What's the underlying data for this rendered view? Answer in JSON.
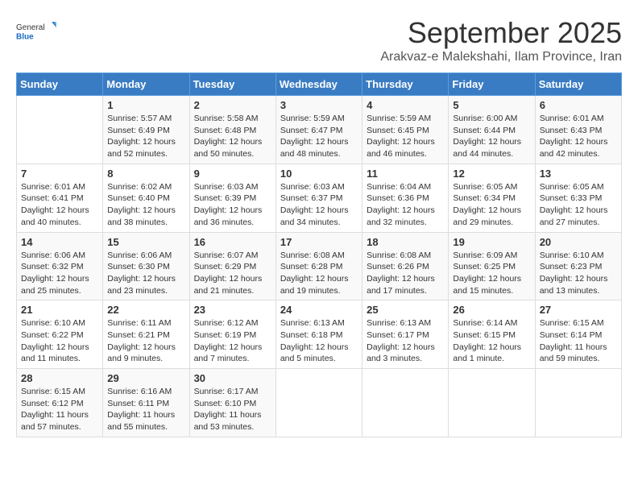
{
  "logo": {
    "general": "General",
    "blue": "Blue"
  },
  "title": "September 2025",
  "location": "Arakvaz-e Malekshahi, Ilam Province, Iran",
  "days_header": [
    "Sunday",
    "Monday",
    "Tuesday",
    "Wednesday",
    "Thursday",
    "Friday",
    "Saturday"
  ],
  "weeks": [
    [
      {
        "day": "",
        "info": ""
      },
      {
        "day": "1",
        "info": "Sunrise: 5:57 AM\nSunset: 6:49 PM\nDaylight: 12 hours\nand 52 minutes."
      },
      {
        "day": "2",
        "info": "Sunrise: 5:58 AM\nSunset: 6:48 PM\nDaylight: 12 hours\nand 50 minutes."
      },
      {
        "day": "3",
        "info": "Sunrise: 5:59 AM\nSunset: 6:47 PM\nDaylight: 12 hours\nand 48 minutes."
      },
      {
        "day": "4",
        "info": "Sunrise: 5:59 AM\nSunset: 6:45 PM\nDaylight: 12 hours\nand 46 minutes."
      },
      {
        "day": "5",
        "info": "Sunrise: 6:00 AM\nSunset: 6:44 PM\nDaylight: 12 hours\nand 44 minutes."
      },
      {
        "day": "6",
        "info": "Sunrise: 6:01 AM\nSunset: 6:43 PM\nDaylight: 12 hours\nand 42 minutes."
      }
    ],
    [
      {
        "day": "7",
        "info": "Sunrise: 6:01 AM\nSunset: 6:41 PM\nDaylight: 12 hours\nand 40 minutes."
      },
      {
        "day": "8",
        "info": "Sunrise: 6:02 AM\nSunset: 6:40 PM\nDaylight: 12 hours\nand 38 minutes."
      },
      {
        "day": "9",
        "info": "Sunrise: 6:03 AM\nSunset: 6:39 PM\nDaylight: 12 hours\nand 36 minutes."
      },
      {
        "day": "10",
        "info": "Sunrise: 6:03 AM\nSunset: 6:37 PM\nDaylight: 12 hours\nand 34 minutes."
      },
      {
        "day": "11",
        "info": "Sunrise: 6:04 AM\nSunset: 6:36 PM\nDaylight: 12 hours\nand 32 minutes."
      },
      {
        "day": "12",
        "info": "Sunrise: 6:05 AM\nSunset: 6:34 PM\nDaylight: 12 hours\nand 29 minutes."
      },
      {
        "day": "13",
        "info": "Sunrise: 6:05 AM\nSunset: 6:33 PM\nDaylight: 12 hours\nand 27 minutes."
      }
    ],
    [
      {
        "day": "14",
        "info": "Sunrise: 6:06 AM\nSunset: 6:32 PM\nDaylight: 12 hours\nand 25 minutes."
      },
      {
        "day": "15",
        "info": "Sunrise: 6:06 AM\nSunset: 6:30 PM\nDaylight: 12 hours\nand 23 minutes."
      },
      {
        "day": "16",
        "info": "Sunrise: 6:07 AM\nSunset: 6:29 PM\nDaylight: 12 hours\nand 21 minutes."
      },
      {
        "day": "17",
        "info": "Sunrise: 6:08 AM\nSunset: 6:28 PM\nDaylight: 12 hours\nand 19 minutes."
      },
      {
        "day": "18",
        "info": "Sunrise: 6:08 AM\nSunset: 6:26 PM\nDaylight: 12 hours\nand 17 minutes."
      },
      {
        "day": "19",
        "info": "Sunrise: 6:09 AM\nSunset: 6:25 PM\nDaylight: 12 hours\nand 15 minutes."
      },
      {
        "day": "20",
        "info": "Sunrise: 6:10 AM\nSunset: 6:23 PM\nDaylight: 12 hours\nand 13 minutes."
      }
    ],
    [
      {
        "day": "21",
        "info": "Sunrise: 6:10 AM\nSunset: 6:22 PM\nDaylight: 12 hours\nand 11 minutes."
      },
      {
        "day": "22",
        "info": "Sunrise: 6:11 AM\nSunset: 6:21 PM\nDaylight: 12 hours\nand 9 minutes."
      },
      {
        "day": "23",
        "info": "Sunrise: 6:12 AM\nSunset: 6:19 PM\nDaylight: 12 hours\nand 7 minutes."
      },
      {
        "day": "24",
        "info": "Sunrise: 6:13 AM\nSunset: 6:18 PM\nDaylight: 12 hours\nand 5 minutes."
      },
      {
        "day": "25",
        "info": "Sunrise: 6:13 AM\nSunset: 6:17 PM\nDaylight: 12 hours\nand 3 minutes."
      },
      {
        "day": "26",
        "info": "Sunrise: 6:14 AM\nSunset: 6:15 PM\nDaylight: 12 hours\nand 1 minute."
      },
      {
        "day": "27",
        "info": "Sunrise: 6:15 AM\nSunset: 6:14 PM\nDaylight: 11 hours\nand 59 minutes."
      }
    ],
    [
      {
        "day": "28",
        "info": "Sunrise: 6:15 AM\nSunset: 6:12 PM\nDaylight: 11 hours\nand 57 minutes."
      },
      {
        "day": "29",
        "info": "Sunrise: 6:16 AM\nSunset: 6:11 PM\nDaylight: 11 hours\nand 55 minutes."
      },
      {
        "day": "30",
        "info": "Sunrise: 6:17 AM\nSunset: 6:10 PM\nDaylight: 11 hours\nand 53 minutes."
      },
      {
        "day": "",
        "info": ""
      },
      {
        "day": "",
        "info": ""
      },
      {
        "day": "",
        "info": ""
      },
      {
        "day": "",
        "info": ""
      }
    ]
  ]
}
